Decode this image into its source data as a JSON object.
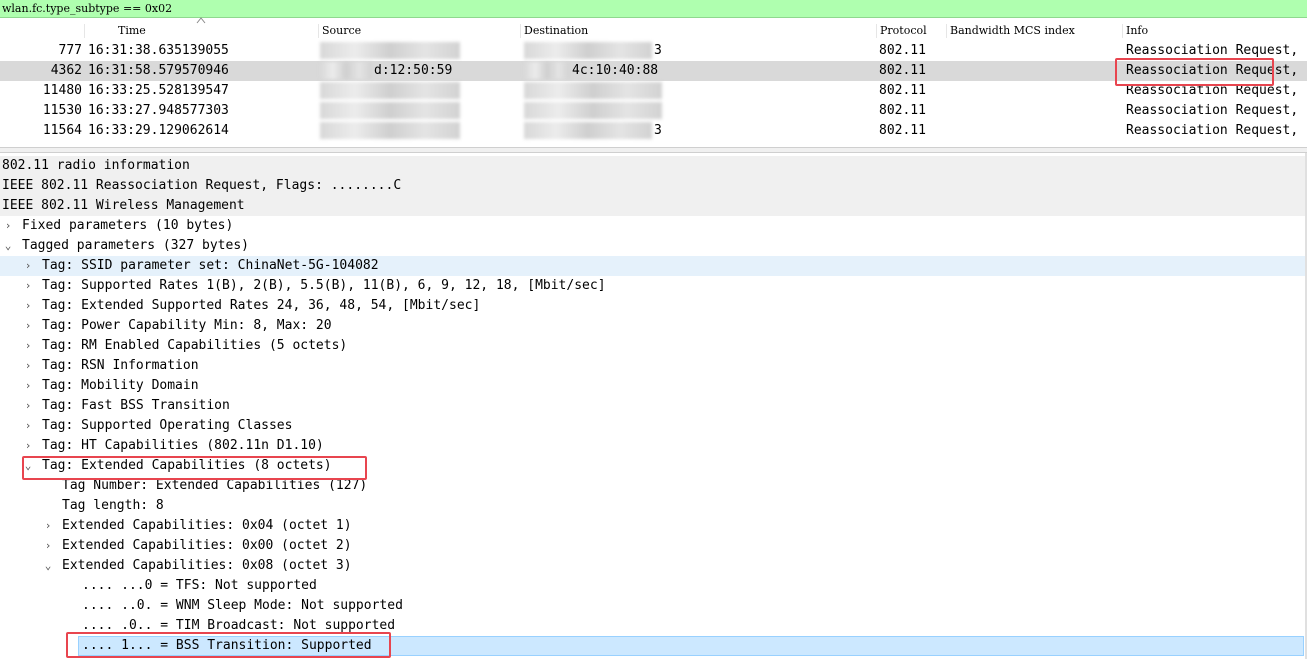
{
  "filter": {
    "text": "wlan.fc.type_subtype == 0x02"
  },
  "columns": {
    "time": "Time",
    "source": "Source",
    "destination": "Destination",
    "protocol": "Protocol",
    "bandwidth": "Bandwidth MCS index",
    "info": "Info"
  },
  "packets": [
    {
      "no": "777",
      "time": "16:31:38.635139055",
      "source": "",
      "destination": "3",
      "protocol": "802.11",
      "info": "Reassociation Request,"
    },
    {
      "no": "4362",
      "time": "16:31:58.579570946",
      "source": "d:12:50:59",
      "destination": "4c:10:40:88",
      "protocol": "802.11",
      "info": "Reassociation Request,"
    },
    {
      "no": "11480",
      "time": "16:33:25.528139547",
      "source": "",
      "destination": "",
      "protocol": "802.11",
      "info": "Reassociation Request,"
    },
    {
      "no": "11530",
      "time": "16:33:27.948577303",
      "source": "",
      "destination": "",
      "protocol": "802.11",
      "info": "Reassociation Request,"
    },
    {
      "no": "11564",
      "time": "16:33:29.129062614",
      "source": "",
      "destination": "3",
      "protocol": "802.11",
      "info": "Reassociation Request,"
    }
  ],
  "details": [
    {
      "text": "802.11 radio information"
    },
    {
      "text": "IEEE 802.11 Reassociation Request, Flags: ........C"
    },
    {
      "text": "IEEE 802.11 Wireless Management"
    },
    {
      "text": "Fixed parameters (10 bytes)",
      "expander": "collapsed"
    },
    {
      "text": "Tagged parameters (327 bytes)",
      "expander": "expanded"
    },
    {
      "text": "Tag: SSID parameter set: ChinaNet-5G-104082",
      "expander": "collapsed"
    },
    {
      "text": "Tag: Supported Rates 1(B), 2(B), 5.5(B), 11(B), 6, 9, 12, 18, [Mbit/sec]",
      "expander": "collapsed"
    },
    {
      "text": "Tag: Extended Supported Rates 24, 36, 48, 54, [Mbit/sec]",
      "expander": "collapsed"
    },
    {
      "text": "Tag: Power Capability Min: 8, Max: 20",
      "expander": "collapsed"
    },
    {
      "text": "Tag: RM Enabled Capabilities (5 octets)",
      "expander": "collapsed"
    },
    {
      "text": "Tag: RSN Information",
      "expander": "collapsed"
    },
    {
      "text": "Tag: Mobility Domain",
      "expander": "collapsed"
    },
    {
      "text": "Tag: Fast BSS Transition",
      "expander": "collapsed"
    },
    {
      "text": "Tag: Supported Operating Classes",
      "expander": "collapsed"
    },
    {
      "text": "Tag: HT Capabilities (802.11n D1.10)",
      "expander": "collapsed"
    },
    {
      "text": "Tag: Extended Capabilities (8 octets)",
      "expander": "expanded"
    },
    {
      "text": "Tag Number: Extended Capabilities (127)"
    },
    {
      "text": "Tag length: 8"
    },
    {
      "text": "Extended Capabilities: 0x04 (octet 1)",
      "expander": "collapsed"
    },
    {
      "text": "Extended Capabilities: 0x00 (octet 2)",
      "expander": "collapsed"
    },
    {
      "text": "Extended Capabilities: 0x08 (octet 3)",
      "expander": "expanded"
    },
    {
      "text": ".... ...0 = TFS: Not supported"
    },
    {
      "text": ".... ..0. = WNM Sleep Mode: Not supported"
    },
    {
      "text": ".... .0.. = TIM Broadcast: Not supported"
    },
    {
      "text": ".... 1... = BSS Transition: Supported"
    }
  ]
}
